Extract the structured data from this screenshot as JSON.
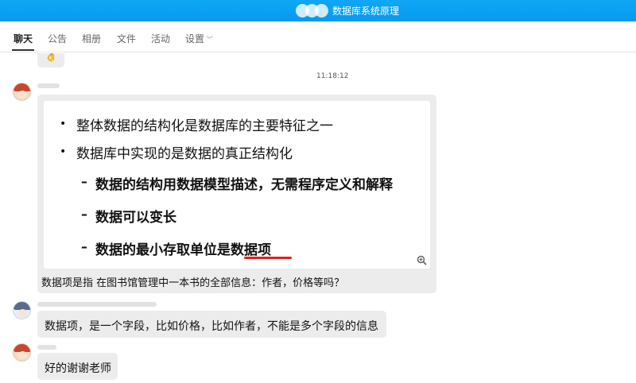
{
  "window": {
    "title": "数据库系统原理"
  },
  "tabs": [
    {
      "label": "聊天"
    },
    {
      "label": "公告"
    },
    {
      "label": "相册"
    },
    {
      "label": "文件"
    },
    {
      "label": "活动"
    },
    {
      "label": "设置"
    }
  ],
  "messages": {
    "emoji": "👌",
    "timestamp": "11:18:12",
    "slide": {
      "items": [
        "整体数据的结构化是数据库的主要特征之一",
        "数据库中实现的是数据的真正结构化",
        "数据的结构用数据模型描述，无需程序定义和解释",
        "数据可以变长",
        "数据的最小存取单位是数据项"
      ]
    },
    "question": "数据项是指 在图书馆管理中一本书的全部信息：作者，价格等吗？",
    "answer": "数据项，是一个字段，比如价格，比如作者，不能是多个字段的信息",
    "thanks": "好的谢谢老师"
  },
  "colors": {
    "titlebar": "#0fa7f5",
    "bubble": "#ececec",
    "highlight": "#e02020"
  }
}
